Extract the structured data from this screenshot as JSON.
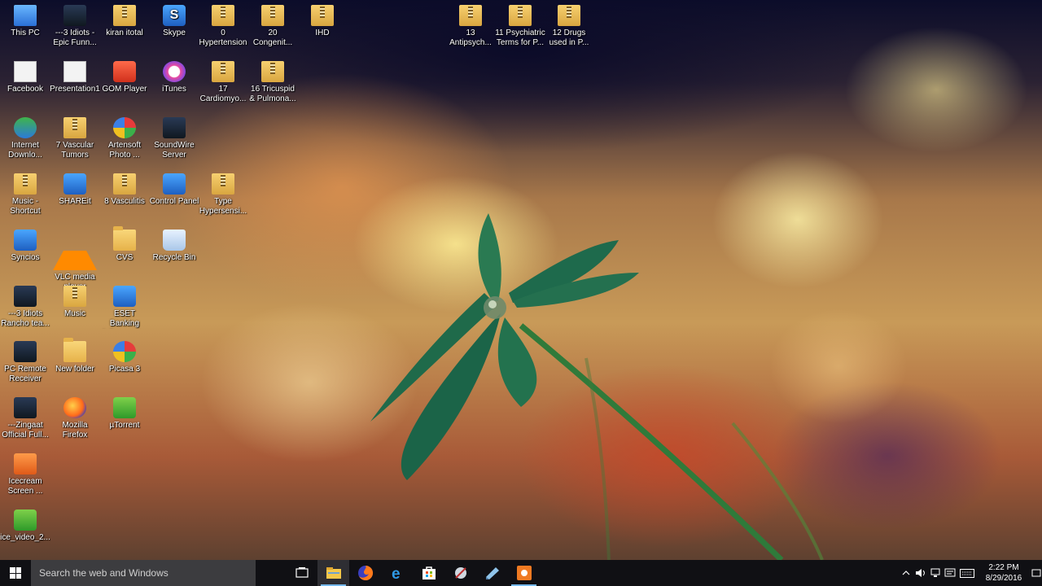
{
  "desktop": {
    "icons": [
      {
        "label": "This PC",
        "type": "pc-icon"
      },
      {
        "label": "---3 Idiots -\nEpic Funn...",
        "type": "video-icon"
      },
      {
        "label": "kiran itotal",
        "type": "zip-icon"
      },
      {
        "label": "Skype",
        "type": "skype-icon"
      },
      {
        "label": "0\nHypertension",
        "type": "zip-icon"
      },
      {
        "label": "20\nCongenit...",
        "type": "zip-icon"
      },
      {
        "label": "IHD",
        "type": "zip-icon"
      },
      {
        "label": "13\nAntipsych...",
        "type": "zip-icon"
      },
      {
        "label": "11 Psychiatric\nTerms for P...",
        "type": "zip-icon"
      },
      {
        "label": "12 Drugs\nused in P...",
        "type": "zip-icon"
      },
      {
        "label": "Facebook",
        "type": "facebook-icon"
      },
      {
        "label": "Presentation1",
        "type": "presentation-icon"
      },
      {
        "label": "GOM Player",
        "type": "gom-player-icon"
      },
      {
        "label": "iTunes",
        "type": "itunes-icon"
      },
      {
        "label": "17\nCardiomyo...",
        "type": "zip-icon"
      },
      {
        "label": "16 Tricuspid\n& Pulmona...",
        "type": "zip-icon"
      },
      {
        "label": "Internet\nDownlo...",
        "type": "idm-icon"
      },
      {
        "label": "7 Vascular\nTumors",
        "type": "zip-icon"
      },
      {
        "label": "Artensoft\nPhoto ...",
        "type": "artensoft-icon"
      },
      {
        "label": "SoundWire\nServer",
        "type": "soundwire-icon"
      },
      {
        "label": "Music -\nShortcut",
        "type": "zip-icon"
      },
      {
        "label": "SHAREit",
        "type": "shareit-icon"
      },
      {
        "label": "8 Vasculitis",
        "type": "zip-icon"
      },
      {
        "label": "Control Panel",
        "type": "control-panel-icon"
      },
      {
        "label": "Type\nHypersensi...",
        "type": "zip-icon"
      },
      {
        "label": "Syncios",
        "type": "syncios-icon"
      },
      {
        "label": "VLC media\nplayer",
        "type": "vlc-icon"
      },
      {
        "label": "CVS",
        "type": "folder-icon"
      },
      {
        "label": "Recycle Bin",
        "type": "recycle-bin-icon"
      },
      {
        "label": "---3 Idiots\nRancho tea...",
        "type": "video-icon"
      },
      {
        "label": "Music",
        "type": "zip-icon"
      },
      {
        "label": "ESET Banking\n& Payment...",
        "type": "eset-icon"
      },
      {
        "label": "PC Remote\nReceiver",
        "type": "pc-remote-icon"
      },
      {
        "label": "New folder",
        "type": "folder-icon"
      },
      {
        "label": "Picasa 3",
        "type": "picasa-icon"
      },
      {
        "label": "---Zingaat\nOfficial Full...",
        "type": "video-icon"
      },
      {
        "label": "Mozilla\nFirefox",
        "type": "firefox-icon"
      },
      {
        "label": "µTorrent",
        "type": "utorrent-icon"
      },
      {
        "label": "Icecream\nScreen ...",
        "type": "icecream-icon"
      },
      {
        "label": "ice_video_2...",
        "type": "video-file-icon"
      }
    ]
  },
  "taskbar": {
    "search_placeholder": "Search the web and Windows",
    "pinned": [
      {
        "name": "task-view-icon"
      },
      {
        "name": "file-explorer-icon",
        "active": true
      },
      {
        "name": "firefox-icon"
      },
      {
        "name": "edge-icon"
      },
      {
        "name": "store-icon"
      },
      {
        "name": "sniping-tool-icon"
      },
      {
        "name": "notes-icon"
      },
      {
        "name": "icecream-recorder-icon",
        "active": true
      }
    ],
    "tray": {
      "time": "2:22 PM",
      "date": "8/29/2016",
      "icons": [
        "chevron-up-icon",
        "volume-icon",
        "network-icon",
        "action-center-icon",
        "keyboard-icon"
      ]
    }
  }
}
